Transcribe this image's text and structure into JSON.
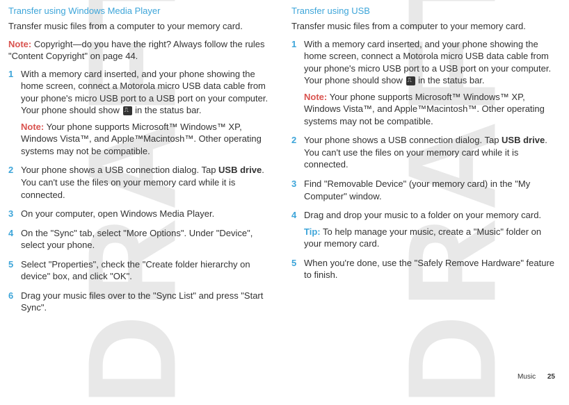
{
  "watermark": "DRAFT",
  "left_column": {
    "heading": "Transfer using Windows Media Player",
    "intro": "Transfer music files from a computer to your memory card.",
    "note": "Copyright—do you have the right? Always follow the rules \"Content Copyright\" on page 44.",
    "note_label": "Note:",
    "steps": [
      {
        "text": "With a memory card inserted, and your phone showing the home screen, connect a Motorola micro USB data cable from your phone's micro USB port to a USB port on your computer. Your phone should show ",
        "text_after_icon": " in the status bar.",
        "note_label": "Note:",
        "note": "Your phone supports Microsoft™ Windows™ XP, Windows Vista™, and Apple™Macintosh™. Other operating systems may not be compatible."
      },
      {
        "text_before_bold": "Your phone shows a USB connection dialog. Tap ",
        "bold": "USB drive",
        "text_after_bold": ". You can't use the files on your memory card while it is connected."
      },
      {
        "text": "On your computer, open Windows Media Player."
      },
      {
        "text": "On the \"Sync\" tab, select \"More Options\". Under \"Device\", select your phone."
      },
      {
        "text": "Select \"Properties\", check the \"Create folder hierarchy on device\" box, and click \"OK\"."
      },
      {
        "text": "Drag your music files over to the \"Sync List\" and press \"Start Sync\"."
      }
    ]
  },
  "right_column": {
    "heading": "Transfer using USB",
    "intro": "Transfer music files from a computer to your memory card.",
    "steps": [
      {
        "text": "With a memory card inserted, and your phone showing the home screen, connect a Motorola micro USB data cable from your phone's micro USB port to a USB port on your computer. Your phone should show ",
        "text_after_icon": " in the status bar.",
        "note_label": "Note:",
        "note": "Your phone supports Microsoft™ Windows™ XP, Windows Vista™, and Apple™Macintosh™. Other operating systems may not be compatible."
      },
      {
        "text_before_bold": "Your phone shows a USB connection dialog. Tap ",
        "bold": "USB drive",
        "text_after_bold": ". You can't use the files on your memory card while it is connected."
      },
      {
        "text": "Find \"Removable Device\" (your memory card) in the \"My Computer\" window."
      },
      {
        "text": "Drag and drop your music to a folder on your memory card.",
        "tip_label": "Tip:",
        "tip": "To help manage your music, create a \"Music\" folder on your memory card."
      },
      {
        "text": "When you're done, use the \"Safely Remove Hardware\" feature to finish."
      }
    ]
  },
  "footer": {
    "section": "Music",
    "page": "25"
  }
}
